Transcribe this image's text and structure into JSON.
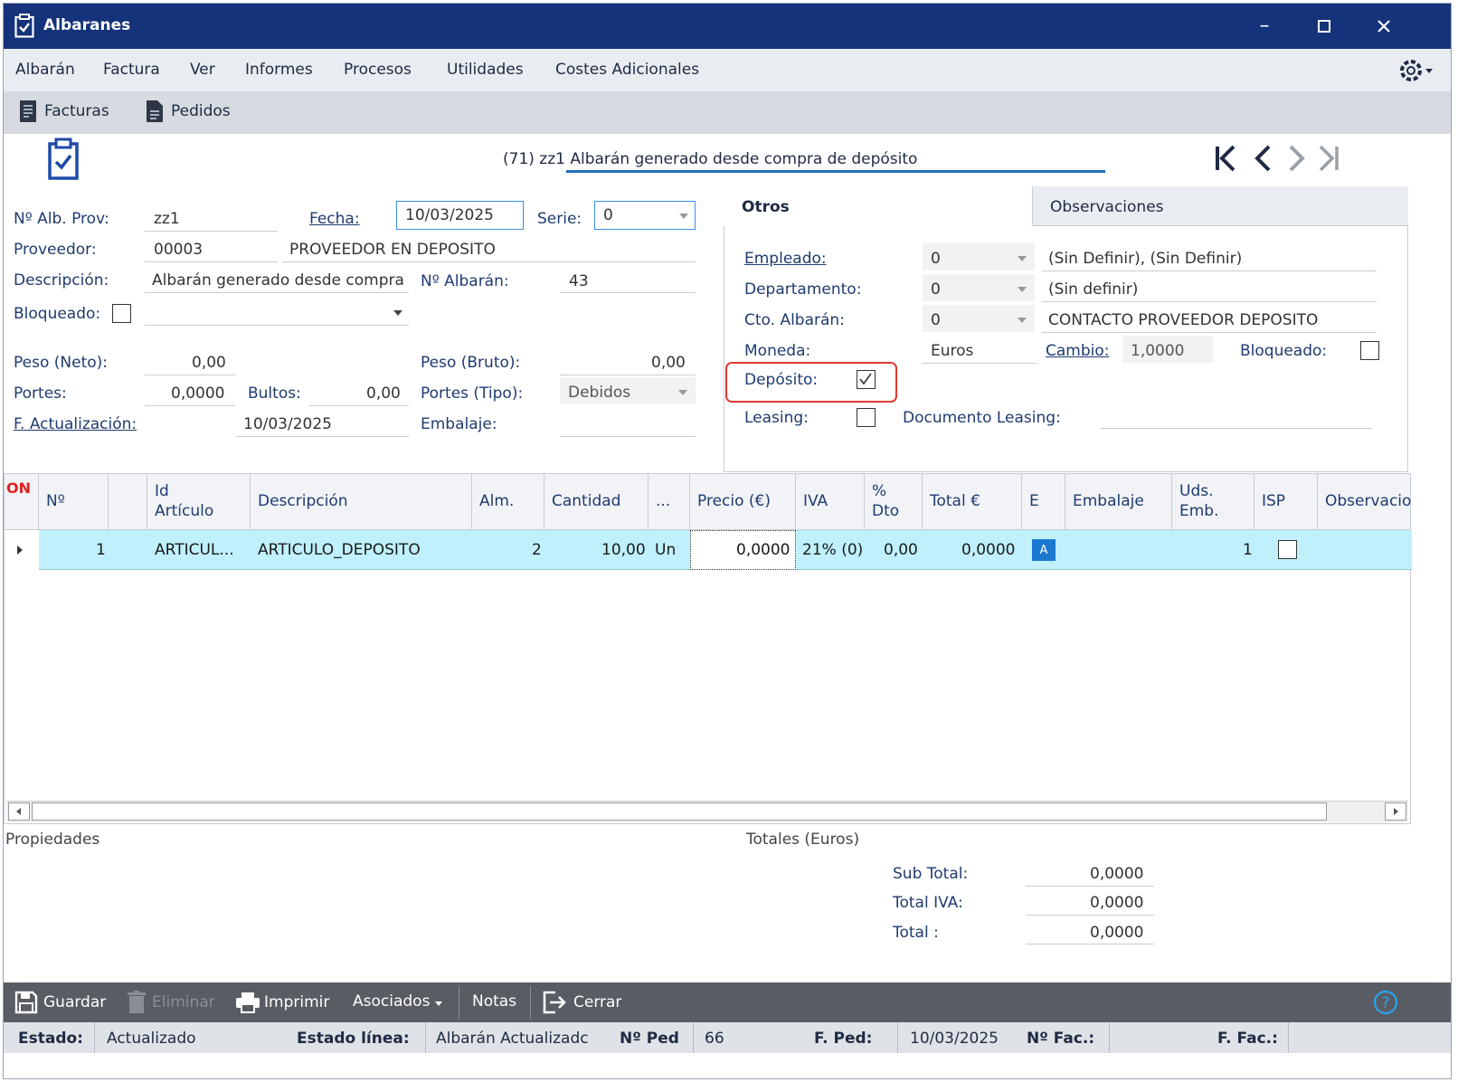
{
  "window": {
    "title": "Albaranes"
  },
  "menu": [
    "Albarán",
    "Factura",
    "Ver",
    "Informes",
    "Procesos",
    "Utilidades",
    "Costes Adicionales"
  ],
  "toolbar": {
    "facturas": "Facturas",
    "pedidos": "Pedidos"
  },
  "header": {
    "text": "(71) zz1 Albarán generado desde compra de depósito"
  },
  "form": {
    "alb_prov_label": "Nº Alb. Prov:",
    "alb_prov_value": "zz1",
    "fecha_label": "Fecha:",
    "fecha_value": "10/03/2025",
    "serie_label": "Serie:",
    "serie_value": "0",
    "proveedor_label": "Proveedor:",
    "proveedor_code": "00003",
    "proveedor_name": "PROVEEDOR EN DEPOSITO",
    "descripcion_label": "Descripción:",
    "descripcion_value": "Albarán generado desde compra",
    "n_albaran_label": "Nº Albarán:",
    "n_albaran_value": "43",
    "bloqueado_label": "Bloqueado:",
    "peso_neto_label": "Peso (Neto):",
    "peso_neto_value": "0,00",
    "peso_bruto_label": "Peso (Bruto):",
    "peso_bruto_value": "0,00",
    "portes_label": "Portes:",
    "portes_value": "0,0000",
    "bultos_label": "Bultos:",
    "bultos_value": "0,00",
    "portes_tipo_label": "Portes (Tipo):",
    "portes_tipo_value": "Debidos",
    "f_actualizacion_label": "F. Actualización:",
    "f_actualizacion_value": "10/03/2025",
    "embalaje_label": "Embalaje:"
  },
  "tabs": {
    "otros": "Otros",
    "observaciones": "Observaciones"
  },
  "otros": {
    "empleado_label": "Empleado:",
    "empleado_value": "0",
    "empleado_desc": "(Sin Definir), (Sin Definir)",
    "departamento_label": "Departamento:",
    "departamento_value": "0",
    "departamento_desc": "(Sin definir)",
    "cto_label": "Cto. Albarán:",
    "cto_value": "0",
    "cto_desc": "CONTACTO PROVEEDOR DEPOSITO",
    "moneda_label": "Moneda:",
    "moneda_value": "Euros",
    "cambio_label": "Cambio:",
    "cambio_value": "1,0000",
    "bloqueado_label": "Bloqueado:",
    "deposito_label": "Depósito:",
    "deposito_checked": true,
    "leasing_label": "Leasing:",
    "leasing_checked": false,
    "doc_leasing_label": "Documento Leasing:"
  },
  "grid": {
    "on_label": "ON",
    "headers": {
      "n": "Nº",
      "id1": "Id",
      "id2": "Artículo",
      "desc": "Descripción",
      "alm": "Alm.",
      "cant": "Cantidad",
      "dots": "...",
      "precio": "Precio (€)",
      "iva": "IVA",
      "dto1": "%",
      "dto2": "Dto",
      "total": "Total €",
      "e": "E",
      "embalaje": "Embalaje",
      "uds1": "Uds.",
      "uds2": "Emb.",
      "isp": "ISP",
      "obs": "Observacio"
    },
    "row": {
      "n": "1",
      "id": "ARTICUL...",
      "desc": "ARTICULO_DEPOSITO",
      "alm": "2",
      "cant": "10,00",
      "unit": "Un",
      "precio": "0,0000",
      "iva": "21% (0)",
      "dto": "0,00",
      "total": "0,0000",
      "e": "A",
      "uds": "1",
      "isp_checked": false
    }
  },
  "bottom": {
    "propiedades": "Propiedades",
    "totales": "Totales (Euros)",
    "subtotal_label": "Sub Total:",
    "subtotal_value": "0,0000",
    "total_iva_label": "Total IVA:",
    "total_iva_value": "0,0000",
    "total_label": "Total :",
    "total_value": "0,0000"
  },
  "actions": {
    "guardar": "Guardar",
    "eliminar": "Eliminar",
    "imprimir": "Imprimir",
    "asociados": "Asociados",
    "notas": "Notas",
    "cerrar": "Cerrar"
  },
  "status": {
    "estado_label": "Estado:",
    "estado_value": "Actualizado",
    "estado_linea_label": "Estado línea:",
    "estado_linea_value": "Albarán Actualizadc",
    "n_ped_label": "Nº Ped",
    "n_ped_value": "66",
    "f_ped_label": "F. Ped:",
    "f_ped_value": "10/03/2025",
    "n_fac_label": "Nº Fac.:",
    "f_fac_label": "F. Fac.:"
  }
}
